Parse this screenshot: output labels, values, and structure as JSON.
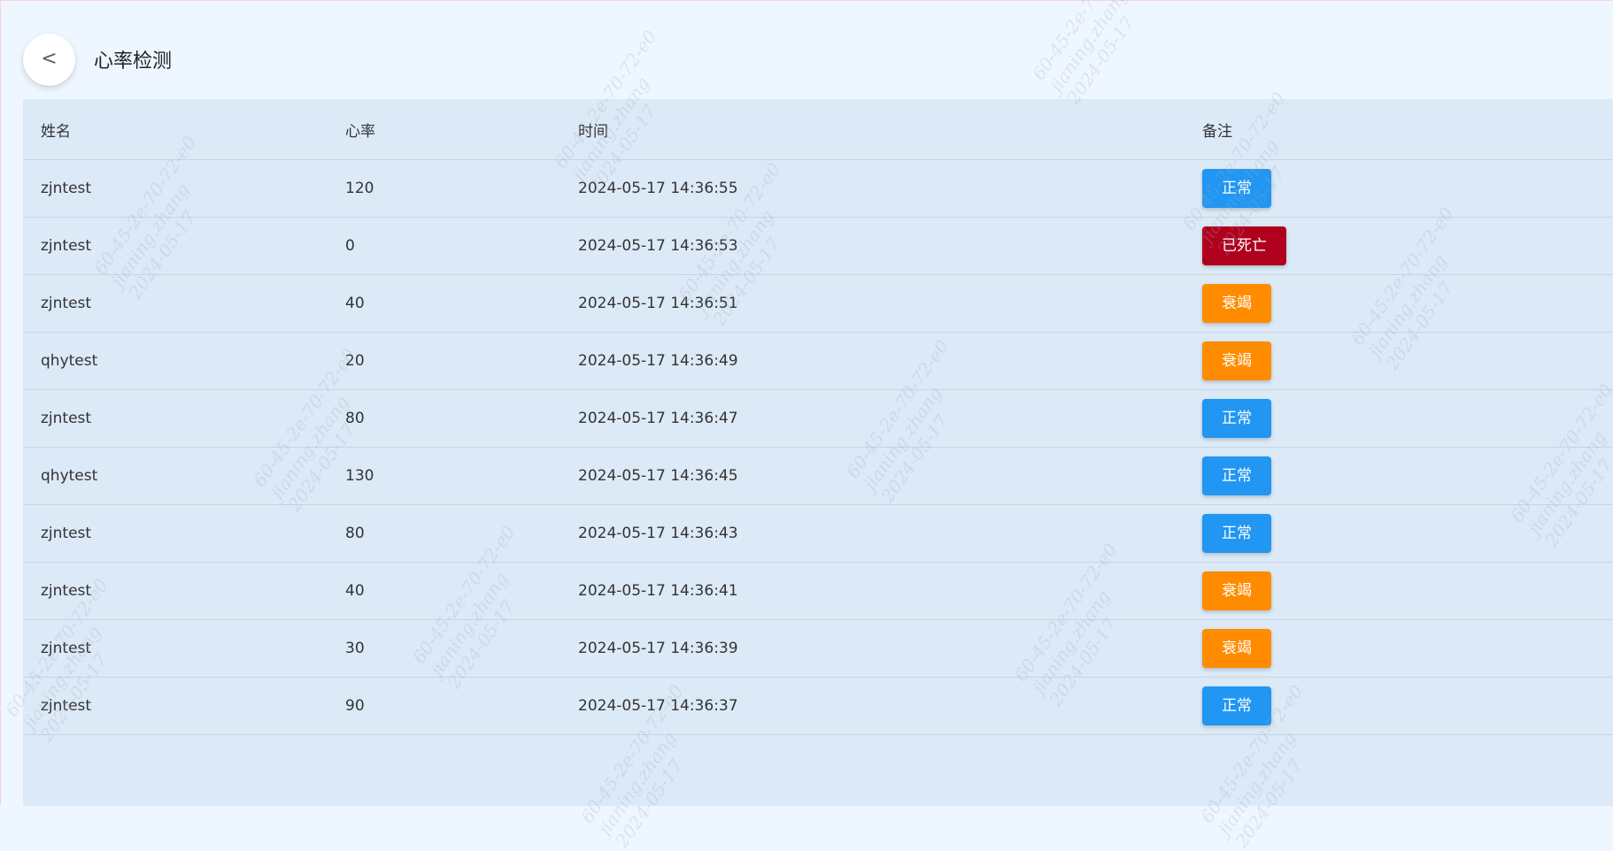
{
  "header": {
    "back_label": "<",
    "title": "心率检测"
  },
  "table": {
    "columns": [
      "姓名",
      "心率",
      "时间",
      "备注"
    ],
    "rows": [
      {
        "name": "zjntest",
        "rate": "120",
        "time": "2024-05-17 14:36:55",
        "status": "正常",
        "status_color": "#2196f3"
      },
      {
        "name": "zjntest",
        "rate": "0",
        "time": "2024-05-17 14:36:53",
        "status": "已死亡",
        "status_color": "#b0001e"
      },
      {
        "name": "zjntest",
        "rate": "40",
        "time": "2024-05-17 14:36:51",
        "status": "衰竭",
        "status_color": "#ff8c00"
      },
      {
        "name": "qhytest",
        "rate": "20",
        "time": "2024-05-17 14:36:49",
        "status": "衰竭",
        "status_color": "#ff8c00"
      },
      {
        "name": "zjntest",
        "rate": "80",
        "time": "2024-05-17 14:36:47",
        "status": "正常",
        "status_color": "#2196f3"
      },
      {
        "name": "qhytest",
        "rate": "130",
        "time": "2024-05-17 14:36:45",
        "status": "正常",
        "status_color": "#2196f3"
      },
      {
        "name": "zjntest",
        "rate": "80",
        "time": "2024-05-17 14:36:43",
        "status": "正常",
        "status_color": "#2196f3"
      },
      {
        "name": "zjntest",
        "rate": "40",
        "time": "2024-05-17 14:36:41",
        "status": "衰竭",
        "status_color": "#ff8c00"
      },
      {
        "name": "zjntest",
        "rate": "30",
        "time": "2024-05-17 14:36:39",
        "status": "衰竭",
        "status_color": "#ff8c00"
      },
      {
        "name": "zjntest",
        "rate": "90",
        "time": "2024-05-17 14:36:37",
        "status": "正常",
        "status_color": "#2196f3"
      }
    ]
  },
  "watermark": {
    "lines": [
      "60-45-2e-70-72-e0",
      "jianing.zhang",
      "2024-05-17"
    ]
  },
  "colors": {
    "page_bg": "#eef6ff",
    "table_bg": "#dce9f7",
    "normal": "#2196f3",
    "dead": "#b0001e",
    "failing": "#ff8c00"
  }
}
